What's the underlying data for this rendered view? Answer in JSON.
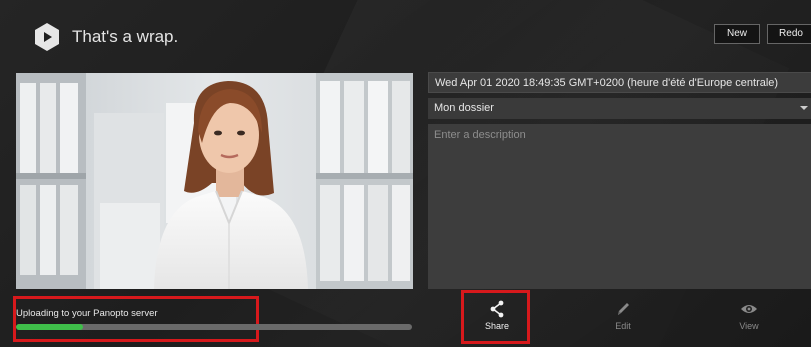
{
  "header": {
    "title": "That's a wrap.",
    "new_label": "New",
    "redo_label": "Redo"
  },
  "recording": {
    "date": "Wed Apr 01 2020 18:49:35 GMT+0200 (heure d'été d'Europe centrale)",
    "folder": "Mon dossier",
    "description_placeholder": "Enter a description",
    "description_value": ""
  },
  "upload": {
    "status_text": "Uploading to your Panopto server",
    "progress_percent": 17
  },
  "actions": {
    "share_label": "Share",
    "edit_label": "Edit",
    "view_label": "View"
  },
  "colors": {
    "accent_green": "#3fbf4a",
    "highlight_red": "#d7191c"
  },
  "icons": {
    "logo": "panopto-play-icon",
    "share": "share-icon",
    "edit": "pencil-icon",
    "view": "eye-icon",
    "folder": "chevron-down-icon"
  }
}
